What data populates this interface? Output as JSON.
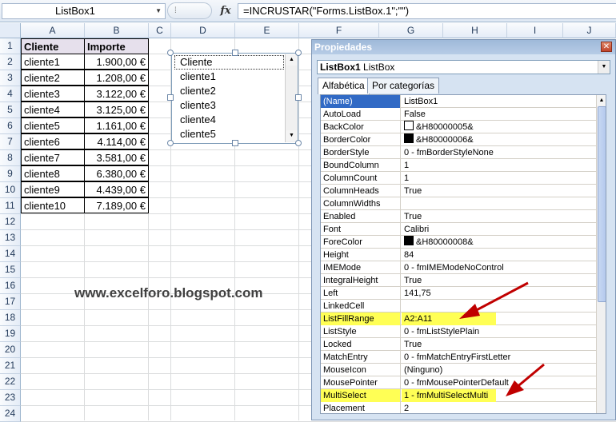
{
  "formula_bar": {
    "name_box": "ListBox1",
    "fx_label": "fx",
    "formula": "=INCRUSTAR(\"Forms.ListBox.1\";\"\")"
  },
  "columns": [
    "A",
    "B",
    "C",
    "D",
    "E",
    "F",
    "G",
    "H",
    "I",
    "J"
  ],
  "rows": [
    "1",
    "2",
    "3",
    "4",
    "5",
    "6",
    "7",
    "8",
    "9",
    "10",
    "11",
    "12",
    "13",
    "14",
    "15",
    "16",
    "17",
    "18",
    "19",
    "20",
    "21",
    "22",
    "23",
    "24"
  ],
  "table": {
    "headers": [
      "Cliente",
      "Importe"
    ],
    "rows": [
      [
        "cliente1",
        "1.900,00 €"
      ],
      [
        "cliente2",
        "1.208,00 €"
      ],
      [
        "cliente3",
        "3.122,00 €"
      ],
      [
        "cliente4",
        "3.125,00 €"
      ],
      [
        "cliente5",
        "1.161,00 €"
      ],
      [
        "cliente6",
        "4.114,00 €"
      ],
      [
        "cliente7",
        "3.581,00 €"
      ],
      [
        "cliente8",
        "6.380,00 €"
      ],
      [
        "cliente9",
        "4.439,00 €"
      ],
      [
        "cliente10",
        "7.189,00 €"
      ]
    ]
  },
  "listbox": {
    "items": [
      "Cliente",
      "cliente1",
      "cliente2",
      "cliente3",
      "cliente4",
      "cliente5"
    ]
  },
  "watermark": "www.excelforo.blogspot.com",
  "properties": {
    "title": "Propiedades",
    "object_name": "ListBox1",
    "object_type": "ListBox",
    "tabs": [
      "Alfabética",
      "Por categorías"
    ],
    "rows": [
      {
        "name": "(Name)",
        "value": "ListBox1"
      },
      {
        "name": "AutoLoad",
        "value": "False"
      },
      {
        "name": "BackColor",
        "value": "&H80000005&"
      },
      {
        "name": "BorderColor",
        "value": "&H80000006&"
      },
      {
        "name": "BorderStyle",
        "value": "0 - fmBorderStyleNone"
      },
      {
        "name": "BoundColumn",
        "value": "1"
      },
      {
        "name": "ColumnCount",
        "value": "1"
      },
      {
        "name": "ColumnHeads",
        "value": "True"
      },
      {
        "name": "ColumnWidths",
        "value": ""
      },
      {
        "name": "Enabled",
        "value": "True"
      },
      {
        "name": "Font",
        "value": "Calibri"
      },
      {
        "name": "ForeColor",
        "value": "&H80000008&"
      },
      {
        "name": "Height",
        "value": "84"
      },
      {
        "name": "IMEMode",
        "value": "0 - fmIMEModeNoControl"
      },
      {
        "name": "IntegralHeight",
        "value": "True"
      },
      {
        "name": "Left",
        "value": "141,75"
      },
      {
        "name": "LinkedCell",
        "value": ""
      },
      {
        "name": "ListFillRange",
        "value": "A2:A11"
      },
      {
        "name": "ListStyle",
        "value": "0 - fmListStylePlain"
      },
      {
        "name": "Locked",
        "value": "True"
      },
      {
        "name": "MatchEntry",
        "value": "0 - fmMatchEntryFirstLetter"
      },
      {
        "name": "MouseIcon",
        "value": "(Ninguno)"
      },
      {
        "name": "MousePointer",
        "value": "0 - fmMousePointerDefault"
      },
      {
        "name": "MultiSelect",
        "value": "1 - fmMultiSelectMulti"
      },
      {
        "name": "Placement",
        "value": "2"
      }
    ]
  },
  "colors": {
    "header_fill": "#e6e0ec",
    "highlight": "#ffff55",
    "arrow": "#c00000",
    "selection": "#316ac5"
  }
}
